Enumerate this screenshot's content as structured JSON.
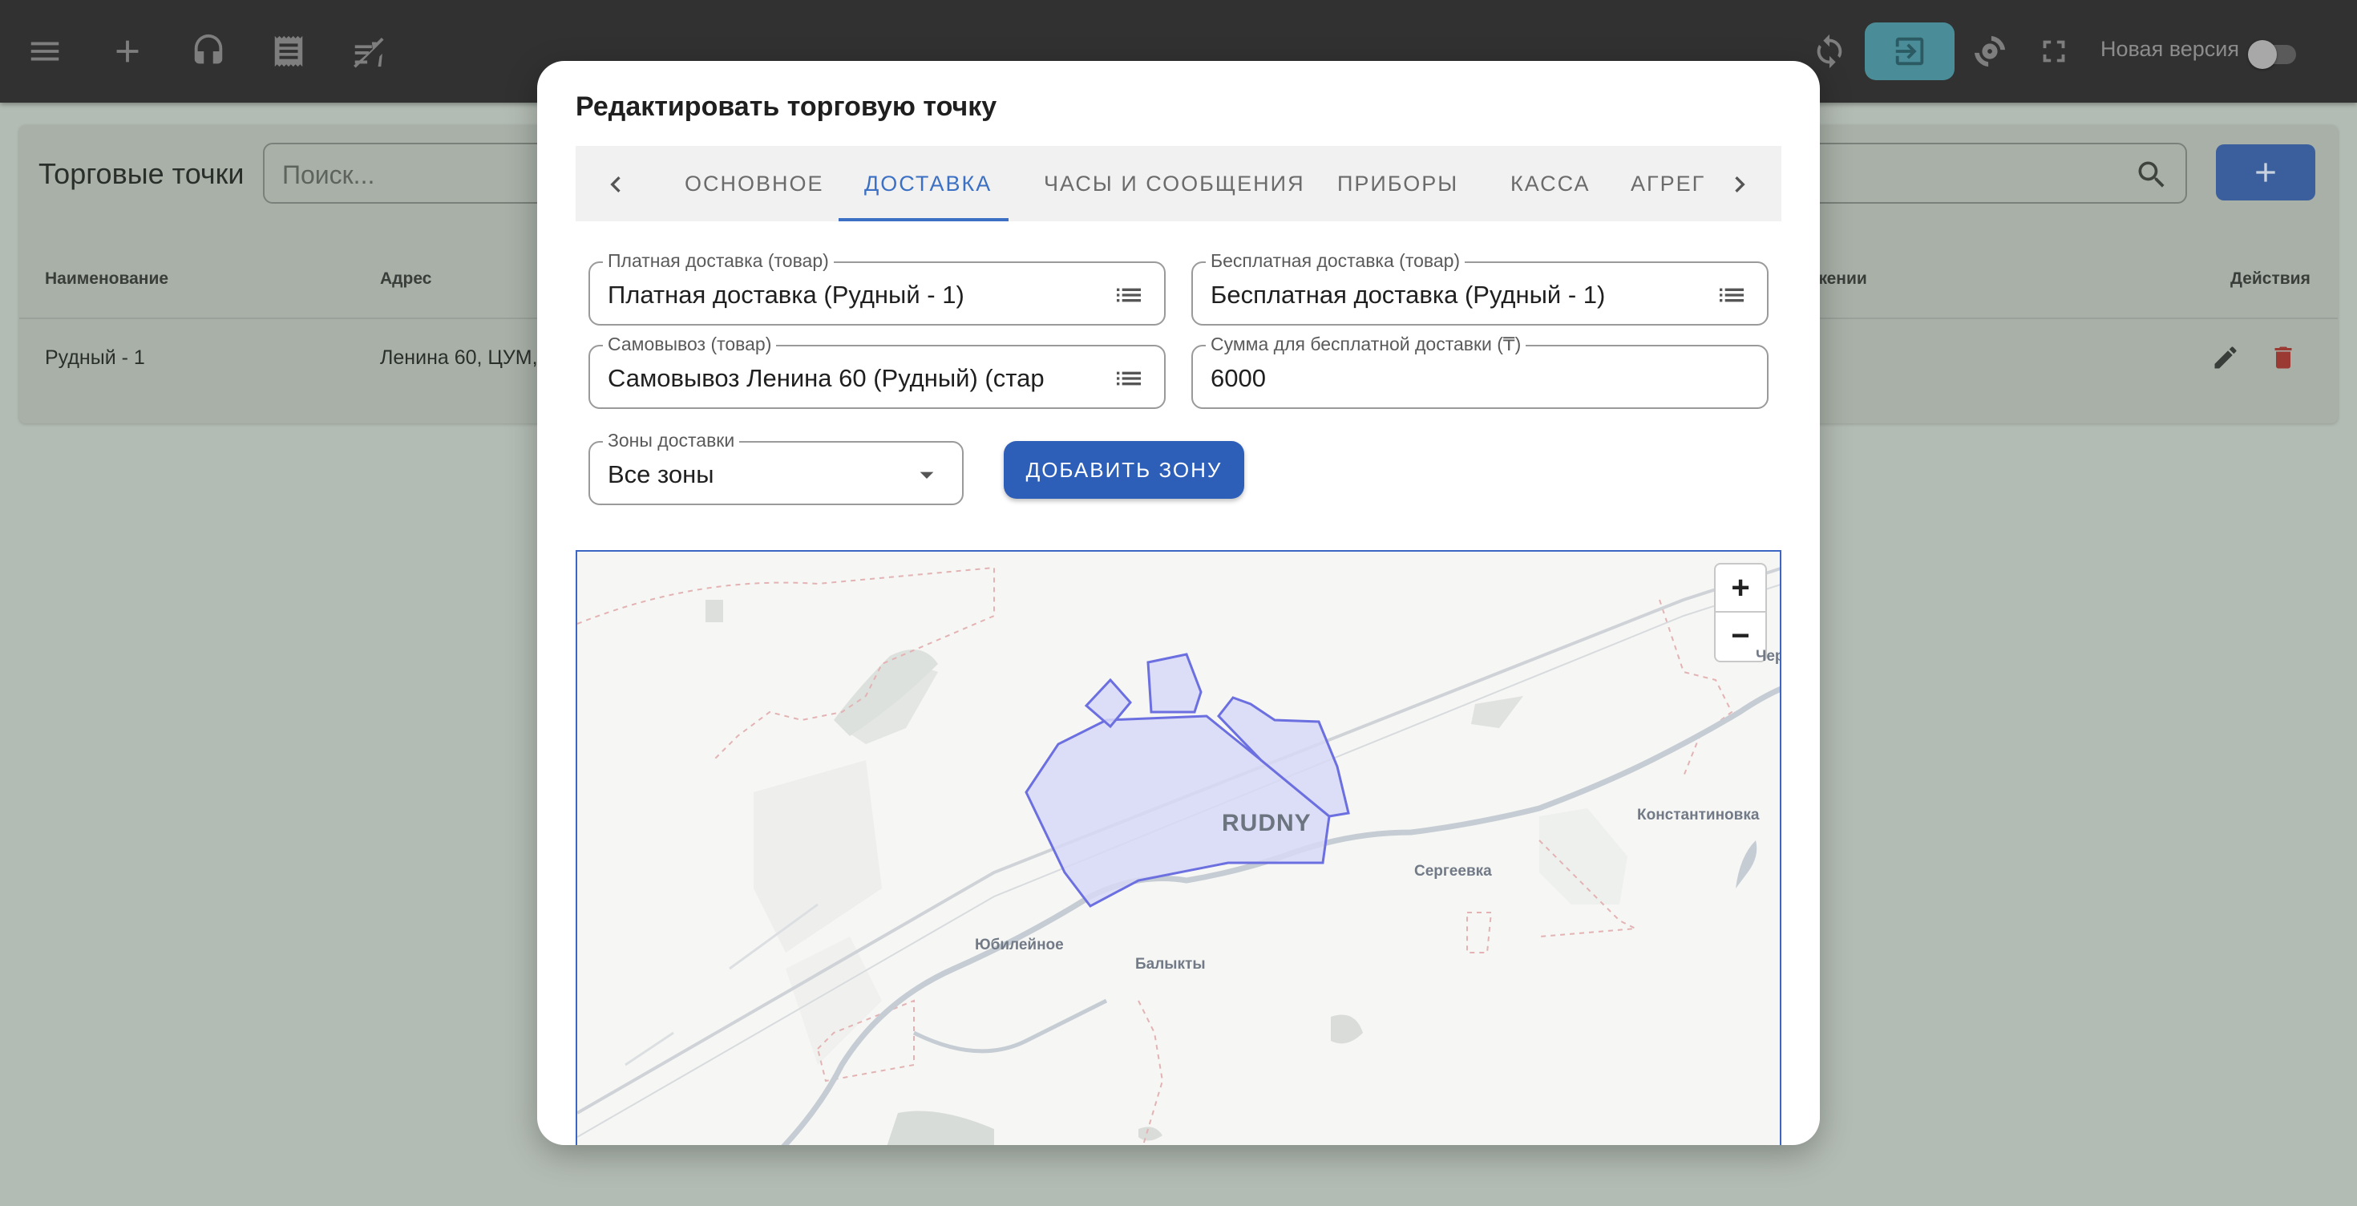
{
  "topbar": {
    "new_version_label": "Новая версия",
    "icons": [
      "menu-icon",
      "add-icon",
      "headset-icon",
      "receipt-icon",
      "no-food-icon",
      "sync-icon",
      "exit-icon",
      "settings-icon",
      "fullscreen-icon"
    ],
    "exit_button_color": "#4a8d98"
  },
  "page": {
    "title": "Торговые точки",
    "search_placeholder": "Поиск...",
    "columns": [
      "Наименование",
      "Адрес",
      "жении",
      "Действия"
    ],
    "rows": [
      {
        "name": "Рудный - 1",
        "address": "Ленина 60, ЦУМ,"
      }
    ]
  },
  "modal": {
    "title": "Редактировать торговую точку",
    "tabs": [
      "ОСНОВНОЕ",
      "ДОСТАВКА",
      "ЧАСЫ И СООБЩЕНИЯ",
      "ПРИБОРЫ",
      "КАССА",
      "АГРЕГ"
    ],
    "active_tab": "ДОСТАВКА",
    "fields": {
      "paid_delivery": {
        "label": "Платная доставка (товар)",
        "value": "Платная доставка (Рудный - 1)"
      },
      "free_delivery": {
        "label": "Бесплатная доставка (товар)",
        "value": "Бесплатная доставка (Рудный - 1)"
      },
      "pickup": {
        "label": "Самовывоз (товар)",
        "value": "Самовывоз Ленина 60 (Рудный) (стар"
      },
      "free_threshold": {
        "label": "Сумма для бесплатной доставки (₸)",
        "value": "6000"
      },
      "zones": {
        "label": "Зоны доставки",
        "value": "Все зоны"
      }
    },
    "add_zone_label": "ДОБАВИТЬ ЗОНУ",
    "accent_color": "#3b70c4",
    "map": {
      "zoom_in": "+",
      "zoom_out": "−",
      "city": "RUDNY",
      "labels": [
        "Константиновка",
        "Сергеевка",
        "Юбилейное",
        "Балыкты",
        "Чер"
      ],
      "zone_color": "#6b6fe0"
    }
  }
}
